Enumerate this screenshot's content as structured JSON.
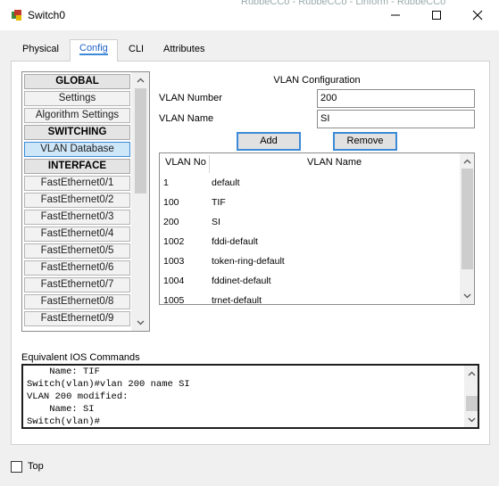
{
  "window": {
    "title": "Switch0",
    "background_sliver_text": "RubbeCCo - RubbeCCo - Linform - RubbeCCo"
  },
  "tabs": [
    {
      "label": "Physical"
    },
    {
      "label": "Config",
      "active": true
    },
    {
      "label": "CLI"
    },
    {
      "label": "Attributes"
    }
  ],
  "sidebar": {
    "items": [
      {
        "label": "GLOBAL",
        "kind": "header"
      },
      {
        "label": "Settings",
        "kind": "item"
      },
      {
        "label": "Algorithm Settings",
        "kind": "item"
      },
      {
        "label": "SWITCHING",
        "kind": "header"
      },
      {
        "label": "VLAN Database",
        "kind": "item",
        "selected": true
      },
      {
        "label": "INTERFACE",
        "kind": "header"
      },
      {
        "label": "FastEthernet0/1",
        "kind": "item"
      },
      {
        "label": "FastEthernet0/2",
        "kind": "item"
      },
      {
        "label": "FastEthernet0/3",
        "kind": "item"
      },
      {
        "label": "FastEthernet0/4",
        "kind": "item"
      },
      {
        "label": "FastEthernet0/5",
        "kind": "item"
      },
      {
        "label": "FastEthernet0/6",
        "kind": "item"
      },
      {
        "label": "FastEthernet0/7",
        "kind": "item"
      },
      {
        "label": "FastEthernet0/8",
        "kind": "item"
      },
      {
        "label": "FastEthernet0/9",
        "kind": "item"
      }
    ]
  },
  "vlan_config": {
    "title": "VLAN Configuration",
    "number_label": "VLAN Number",
    "number_value": "200",
    "name_label": "VLAN Name",
    "name_value": "SI",
    "add_label": "Add",
    "remove_label": "Remove",
    "table": {
      "headers": [
        "VLAN No",
        "VLAN Name"
      ],
      "rows": [
        [
          "1",
          "default"
        ],
        [
          "100",
          "TIF"
        ],
        [
          "200",
          "SI"
        ],
        [
          "1002",
          "fddi-default"
        ],
        [
          "1003",
          "token-ring-default"
        ],
        [
          "1004",
          "fddinet-default"
        ],
        [
          "1005",
          "trnet-default"
        ]
      ]
    }
  },
  "ios": {
    "label": "Equivalent IOS Commands",
    "lines": [
      "    Name: TIF",
      "Switch(vlan)#vlan 200 name SI",
      "VLAN 200 modified:",
      "    Name: SI",
      "Switch(vlan)#"
    ]
  },
  "footer": {
    "top_label": "Top",
    "top_checked": false
  },
  "icons": {
    "window": "switch-app-icon",
    "minimize": "minimize-icon",
    "maximize": "maximize-icon",
    "close": "close-icon",
    "scroll_up": "chevron-up-icon",
    "scroll_down": "chevron-down-icon"
  }
}
